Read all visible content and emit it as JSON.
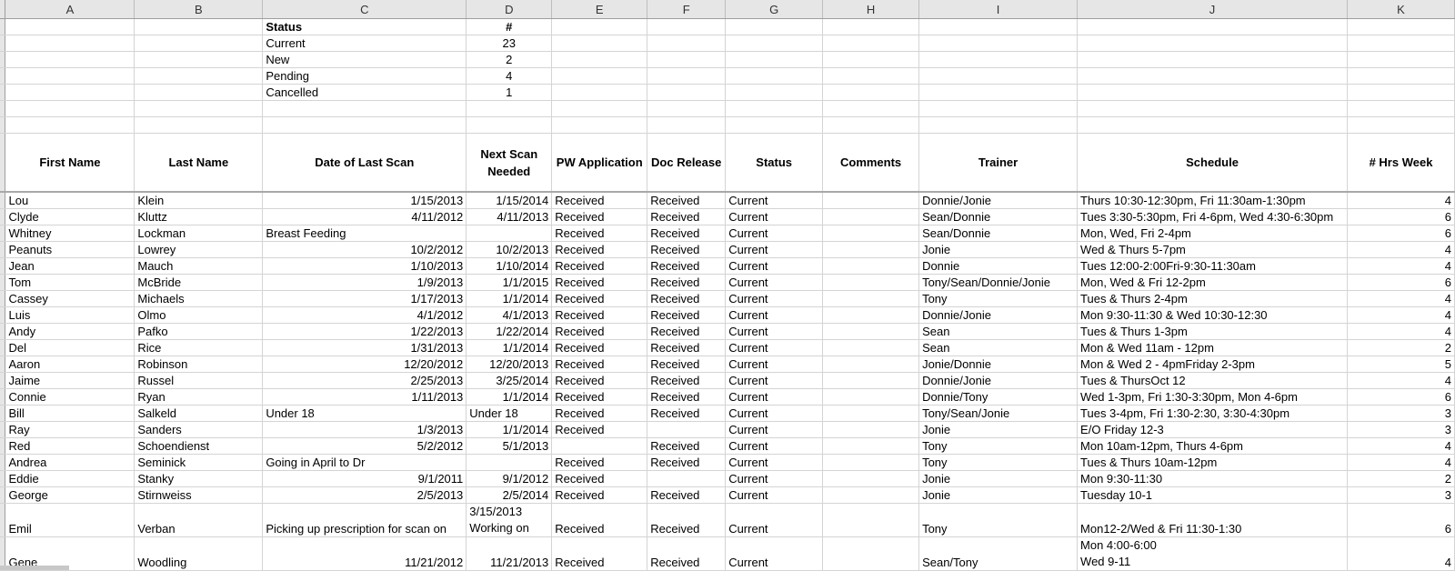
{
  "columns": [
    "A",
    "B",
    "C",
    "D",
    "E",
    "F",
    "G",
    "H",
    "I",
    "J",
    "K"
  ],
  "summary": [
    {
      "label": "Status",
      "value": "#"
    },
    {
      "label": "Current",
      "value": "23"
    },
    {
      "label": "New",
      "value": "2"
    },
    {
      "label": "Pending",
      "value": "4"
    },
    {
      "label": "Cancelled",
      "value": "1"
    }
  ],
  "headers": {
    "first_name": "First Name",
    "last_name": "Last Name",
    "date_last_scan": "Date of Last Scan",
    "next_scan": "Next Scan Needed",
    "pw_application": "PW Application",
    "doc_release": "Doc Release",
    "status": "Status",
    "comments": "Comments",
    "trainer": "Trainer",
    "schedule": "Schedule",
    "hrs_week": "# Hrs Week"
  },
  "rows": [
    {
      "first": "Lou",
      "last": "Klein",
      "last_scan": "1/15/2013",
      "next_scan": "1/15/2014",
      "pw": "Received",
      "doc": "Received",
      "status": "Current",
      "comments": "",
      "trainer": "Donnie/Jonie",
      "schedule": "Thurs 10:30-12:30pm, Fri 11:30am-1:30pm",
      "hrs": "4"
    },
    {
      "first": "Clyde",
      "last": "Kluttz",
      "last_scan": "4/11/2012",
      "next_scan": "4/11/2013",
      "pw": "Received",
      "doc": "Received",
      "status": "Current",
      "comments": "",
      "trainer": "Sean/Donnie",
      "schedule": "Tues 3:30-5:30pm, Fri 4-6pm, Wed 4:30-6:30pm",
      "hrs": "6"
    },
    {
      "first": "Whitney",
      "last": "Lockman",
      "last_scan": "Breast Feeding",
      "next_scan": "",
      "pw": "Received",
      "doc": "Received",
      "status": "Current",
      "comments": "",
      "trainer": "Sean/Donnie",
      "schedule": "Mon, Wed, Fri 2-4pm",
      "hrs": "6"
    },
    {
      "first": "Peanuts",
      "last": "Lowrey",
      "last_scan": "10/2/2012",
      "next_scan": "10/2/2013",
      "pw": "Received",
      "doc": "Received",
      "status": "Current",
      "comments": "",
      "trainer": "Jonie",
      "schedule": "Wed & Thurs 5-7pm",
      "hrs": "4"
    },
    {
      "first": "Jean",
      "last": "Mauch",
      "last_scan": "1/10/2013",
      "next_scan": "1/10/2014",
      "pw": "Received",
      "doc": "Received",
      "status": "Current",
      "comments": "",
      "trainer": "Donnie",
      "schedule": "Tues 12:00-2:00Fri-9:30-11:30am",
      "hrs": "4"
    },
    {
      "first": "Tom",
      "last": "McBride",
      "last_scan": "1/9/2013",
      "next_scan": "1/1/2015",
      "pw": "Received",
      "doc": "Received",
      "status": "Current",
      "comments": "",
      "trainer": "Tony/Sean/Donnie/Jonie",
      "schedule": "Mon, Wed & Fri 12-2pm",
      "hrs": "6"
    },
    {
      "first": "Cassey",
      "last": "Michaels",
      "last_scan": "1/17/2013",
      "next_scan": "1/1/2014",
      "pw": "Received",
      "doc": "Received",
      "status": "Current",
      "comments": "",
      "trainer": "Tony",
      "schedule": "Tues & Thurs 2-4pm",
      "hrs": "4"
    },
    {
      "first": "Luis",
      "last": "Olmo",
      "last_scan": "4/1/2012",
      "next_scan": "4/1/2013",
      "pw": "Received",
      "doc": "Received",
      "status": "Current",
      "comments": "",
      "trainer": "Donnie/Jonie",
      "schedule": "Mon 9:30-11:30 & Wed 10:30-12:30",
      "hrs": "4"
    },
    {
      "first": "Andy",
      "last": "Pafko",
      "last_scan": "1/22/2013",
      "next_scan": "1/22/2014",
      "pw": "Received",
      "doc": "Received",
      "status": "Current",
      "comments": "",
      "trainer": "Sean",
      "schedule": "Tues & Thurs 1-3pm",
      "hrs": "4"
    },
    {
      "first": "Del",
      "last": "Rice",
      "last_scan": "1/31/2013",
      "next_scan": "1/1/2014",
      "pw": "Received",
      "doc": "Received",
      "status": "Current",
      "comments": "",
      "trainer": "Sean",
      "schedule": "Mon & Wed 11am - 12pm",
      "hrs": "2"
    },
    {
      "first": "Aaron",
      "last": "Robinson",
      "last_scan": "12/20/2012",
      "next_scan": "12/20/2013",
      "pw": "Received",
      "doc": "Received",
      "status": "Current",
      "comments": "",
      "trainer": "Jonie/Donnie",
      "schedule": "Mon & Wed 2 - 4pmFriday 2-3pm",
      "hrs": "5"
    },
    {
      "first": "Jaime",
      "last": "Russel",
      "last_scan": "2/25/2013",
      "next_scan": "3/25/2014",
      "pw": "Received",
      "doc": "Received",
      "status": "Current",
      "comments": "",
      "trainer": "Donnie/Jonie",
      "schedule": "Tues & ThursOct 12",
      "hrs": "4"
    },
    {
      "first": "Connie",
      "last": "Ryan",
      "last_scan": "1/11/2013",
      "next_scan": "1/1/2014",
      "pw": "Received",
      "doc": "Received",
      "status": "Current",
      "comments": "",
      "trainer": "Donnie/Tony",
      "schedule": "Wed 1-3pm, Fri 1:30-3:30pm, Mon 4-6pm",
      "hrs": "6"
    },
    {
      "first": "Bill",
      "last": "Salkeld",
      "last_scan": "Under 18",
      "next_scan": "Under 18",
      "pw": "Received",
      "doc": "Received",
      "status": "Current",
      "comments": "",
      "trainer": "Tony/Sean/Jonie",
      "schedule": "Tues 3-4pm, Fri 1:30-2:30, 3:30-4:30pm",
      "hrs": "3"
    },
    {
      "first": "Ray",
      "last": "Sanders",
      "last_scan": "1/3/2013",
      "next_scan": "1/1/2014",
      "pw": "Received",
      "doc": "",
      "status": "Current",
      "comments": "",
      "trainer": "Jonie",
      "schedule": "E/O Friday 12-3",
      "hrs": "3"
    },
    {
      "first": "Red",
      "last": "Schoendienst",
      "last_scan": "5/2/2012",
      "next_scan": "5/1/2013",
      "pw": "",
      "doc": "Received",
      "status": "Current",
      "comments": "",
      "trainer": "Tony",
      "schedule": "Mon 10am-12pm, Thurs 4-6pm",
      "hrs": "4"
    },
    {
      "first": "Andrea",
      "last": "Seminick",
      "last_scan": "Going in April to Dr",
      "next_scan": "",
      "pw": "Received",
      "doc": "Received",
      "status": "Current",
      "comments": "",
      "trainer": "Tony",
      "schedule": "Tues & Thurs 10am-12pm",
      "hrs": "4"
    },
    {
      "first": "Eddie",
      "last": "Stanky",
      "last_scan": "9/1/2011",
      "next_scan": "9/1/2012",
      "pw": "Received",
      "doc": "",
      "status": "Current",
      "comments": "",
      "trainer": "Jonie",
      "schedule": "Mon 9:30-11:30",
      "hrs": "2"
    },
    {
      "first": "George",
      "last": "Stirnweiss",
      "last_scan": "2/5/2013",
      "next_scan": "2/5/2014",
      "pw": "Received",
      "doc": "Received",
      "status": "Current",
      "comments": "",
      "trainer": "Jonie",
      "schedule": "Tuesday 10-1",
      "hrs": "3"
    }
  ],
  "emil": {
    "first": "Emil",
    "last": "Verban",
    "last_scan": "Picking up prescription for scan on",
    "next_scan_1": "3/15/2013",
    "next_scan_2": "Working on",
    "pw": "Received",
    "doc": "Received",
    "status": "Current",
    "trainer": "Tony",
    "schedule": "Mon12-2/Wed & Fri 11:30-1:30",
    "hrs": "6"
  },
  "gene": {
    "first": "Gene",
    "last": "Woodling",
    "last_scan": "11/21/2012",
    "next_scan": "11/21/2013",
    "pw": "Received",
    "doc": "Received",
    "status": "Current",
    "trainer": "Sean/Tony",
    "schedule_1": "Mon 4:00-6:00",
    "schedule_2": "Wed 9-11",
    "hrs": "4"
  }
}
